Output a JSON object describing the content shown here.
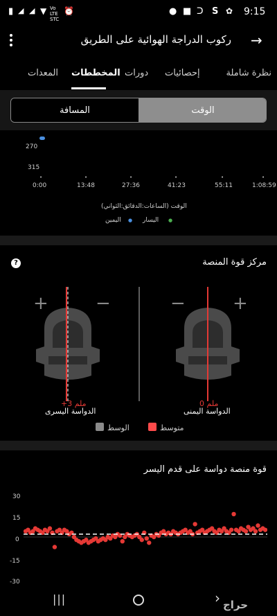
{
  "status_bar": {
    "time": "9:15",
    "carrier": "Vo LTE STC",
    "icons": [
      "alarm-icon",
      "signal-icon",
      "wifi-icon",
      "battery-icon",
      "notification-s-icon",
      "settings-icon"
    ]
  },
  "header": {
    "title": "ركوب الدراجة الهوائية على الطريق",
    "back_icon": "arrow-right-icon",
    "menu_icon": "more-vert-icon"
  },
  "tabs": [
    {
      "label": "نظرة شاملة",
      "active": false
    },
    {
      "label": "إحصائيات",
      "active": false
    },
    {
      "label": "دورات",
      "active": false
    },
    {
      "label": "المخططات",
      "active": true
    },
    {
      "label": "المعدات",
      "active": false
    }
  ],
  "segmented": {
    "time_label": "الوقت",
    "distance_label": "المسافة",
    "selected": "time"
  },
  "chart_top": {
    "y_ticks": [
      "270",
      "315"
    ],
    "x_ticks": [
      "0:00",
      "13:48",
      "27:36",
      "41:23",
      "55:11",
      "1:08:59"
    ],
    "x_label": "الوقت (الساعات:الدقائق:الثواني)",
    "legend": [
      {
        "label": "اليسار",
        "color": "#4caf50"
      },
      {
        "label": "اليمين",
        "color": "#4a8fe0"
      }
    ]
  },
  "platform_center": {
    "title": "مركز قوة المنصة",
    "help_icon": "help-icon",
    "left_pedal": {
      "offset_label": "+3 ملم",
      "name": "الدواسة اليسرى",
      "offset_mm": 3
    },
    "right_pedal": {
      "offset_label": "0 ملم",
      "name": "الدواسة اليمنى",
      "offset_mm": 0
    },
    "legend_average": "متوسط",
    "legend_center": "الوسط",
    "average_color": "#ff4b4b",
    "center_color": "#8a8a8a"
  },
  "scatter": {
    "title": "قوة منصة دواسة على قدم اليسر",
    "y_ticks": [
      "30",
      "15",
      "0",
      "-15",
      "-30"
    ]
  },
  "chart_data": {
    "type": "scatter",
    "title": "قوة منصة دواسة على قدم اليسر",
    "ylim": [
      -30,
      30
    ],
    "y_ticks": [
      30,
      15,
      0,
      -15,
      -30
    ],
    "series": [
      {
        "color": "#e53935",
        "x": [
          1,
          2,
          3,
          4,
          5,
          6,
          7,
          8,
          9,
          10,
          11,
          12,
          13,
          14,
          15,
          16,
          17,
          18,
          19,
          20,
          21,
          22,
          23,
          24,
          25,
          26,
          27,
          28,
          29,
          30,
          31,
          32,
          33,
          34,
          35,
          36,
          37,
          38,
          39,
          40,
          41,
          42,
          43,
          44,
          45,
          46,
          47,
          48,
          49,
          50,
          51,
          52,
          53,
          54,
          55,
          56,
          57,
          58,
          59,
          60,
          61,
          62,
          63,
          64,
          65,
          66,
          67,
          68,
          69,
          70,
          71,
          72,
          73,
          74,
          75,
          76,
          77,
          78,
          79,
          80,
          81,
          82,
          83,
          84,
          85,
          86,
          87,
          88,
          89,
          90,
          91,
          92,
          93,
          94,
          95,
          96,
          97,
          98,
          99,
          100
        ],
        "y": [
          4,
          5,
          3,
          4,
          6,
          5,
          4,
          3,
          5,
          4,
          6,
          3,
          -7,
          4,
          5,
          3,
          5,
          4,
          2,
          3,
          0,
          -2,
          -3,
          -4,
          -3,
          -2,
          -4,
          -3,
          -2,
          -1,
          -3,
          -2,
          -1,
          -2,
          0,
          -1,
          1,
          0,
          2,
          1,
          -3,
          0,
          2,
          1,
          0,
          1,
          2,
          0,
          -2,
          3,
          -1,
          -4,
          1,
          0,
          2,
          1,
          3,
          4,
          2,
          3,
          2,
          4,
          3,
          2,
          3,
          4,
          5,
          3,
          4,
          2,
          9,
          3,
          4,
          5,
          3,
          4,
          5,
          6,
          4,
          3,
          5,
          4,
          6,
          4,
          3,
          5,
          16,
          5,
          4,
          6,
          5,
          4,
          7,
          5,
          6,
          4,
          8,
          5,
          6,
          5
        ]
      }
    ],
    "mean_line_y": 2
  },
  "nav_bar": {
    "icons": [
      "recents-icon",
      "home-icon",
      "back-icon"
    ],
    "watermark": "حراج"
  }
}
